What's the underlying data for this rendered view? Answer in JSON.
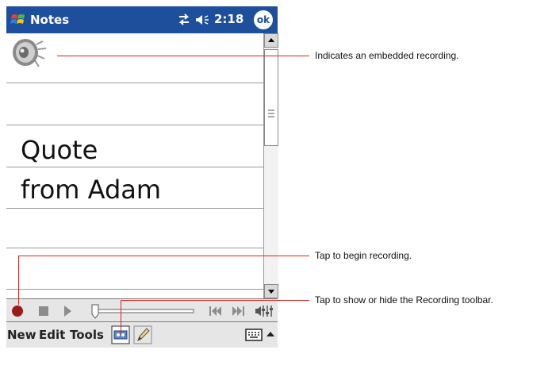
{
  "titlebar": {
    "app_name": "Notes",
    "time": "2:18",
    "ok_label": "ok",
    "color": "#1d4f9c"
  },
  "note": {
    "lines": [
      "Quote",
      "from Adam"
    ]
  },
  "menubar": {
    "items": [
      "New",
      "Edit",
      "Tools"
    ]
  },
  "callouts": {
    "recording": "Indicates an embedded recording.",
    "record": "Tap to begin recording.",
    "toolbar": "Tap to show or hide the Recording toolbar."
  },
  "colors": {
    "callout": "#d9241f",
    "record_button": "#9b1b1b",
    "toolbar_bg": "#e6e6e6"
  }
}
